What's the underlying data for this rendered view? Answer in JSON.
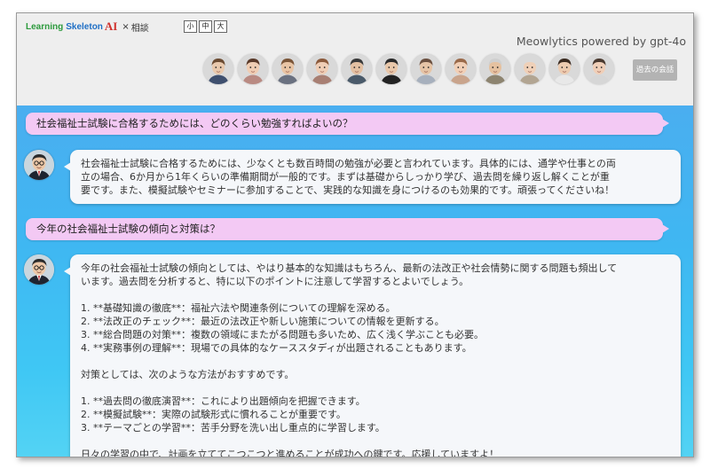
{
  "header": {
    "brand_learning": "Learning",
    "brand_skeleton": "Skeleton",
    "brand_ai": "AI",
    "brand_x": "×",
    "brand_consult": "相談",
    "font_sizes": [
      "小",
      "中",
      "大"
    ],
    "powered_by": "Meowlytics powered by gpt-4o",
    "past_conversations": "過去の会話"
  },
  "avatars": [
    {
      "icon": "businessman-avatar-icon",
      "skin": "#e9c9ad",
      "hair": "#6b4b32",
      "shirt": "#3e4f6e"
    },
    {
      "icon": "woman-avatar-icon",
      "skin": "#f0cdb3",
      "hair": "#5a3a2a",
      "shirt": "#b98a82"
    },
    {
      "icon": "man-avatar-icon",
      "skin": "#e8c4a4",
      "hair": "#7a5538",
      "shirt": "#6a7180"
    },
    {
      "icon": "woman-avatar-icon",
      "skin": "#efcdb5",
      "hair": "#8b5a3c",
      "shirt": "#a87f73"
    },
    {
      "icon": "man-avatar-icon",
      "skin": "#e3c0a2",
      "hair": "#3a3a3a",
      "shirt": "#4a5a6a"
    },
    {
      "icon": "glasses-man-avatar-icon",
      "skin": "#e8c7aa",
      "hair": "#2a2a2a",
      "shirt": "#222222"
    },
    {
      "icon": "man-avatar-icon",
      "skin": "#e6c4a6",
      "hair": "#6b5040",
      "shirt": "#a7b0bd"
    },
    {
      "icon": "woman-avatar-icon",
      "skin": "#f1cfb6",
      "hair": "#9a6a4a",
      "shirt": "#c9a48c"
    },
    {
      "icon": "elder-man-avatar-icon",
      "skin": "#e5c1a0",
      "hair": "#cfcfcf",
      "shirt": "#8d8470"
    },
    {
      "icon": "elder-woman-avatar-icon",
      "skin": "#efd0b8",
      "hair": "#d9d9d9",
      "shirt": "#b2a592"
    },
    {
      "icon": "young-man-avatar-icon",
      "skin": "#eccbb0",
      "hair": "#3a2a20",
      "shirt": "#e8e8e8"
    },
    {
      "icon": "woman-avatar-icon",
      "skin": "#f0cfb8",
      "hair": "#4a3a30",
      "shirt": "#d6d6d6"
    }
  ],
  "messages": [
    {
      "role": "user",
      "text": "社会福祉士試験に合格するためには、どのくらい勉強すればよいの？"
    },
    {
      "role": "assistant",
      "icon": "assistant-avatar-icon",
      "lines": [
        "社会福祉士試験に合格するためには、少なくとも数百時間の勉強が必要と言われています。具体的には、通学や仕事との両",
        "立の場合、6か月から1年くらいの準備期間が一般的です。まずは基礎からしっかり学び、過去問を繰り返し解くことが重",
        "要です。また、模擬試験やセミナーに参加することで、実践的な知識を身につけるのも効果的です。頑張ってくださいね！"
      ]
    },
    {
      "role": "user",
      "text": "今年の社会福祉士試験の傾向と対策は？"
    },
    {
      "role": "assistant",
      "icon": "assistant-avatar-icon",
      "lines": [
        "今年の社会福祉士試験の傾向としては、やはり基本的な知識はもちろん、最新の法改正や社会情勢に関する問題も頻出して",
        "います。過去問を分析すると、特に以下のポイントに注意して学習するとよいでしょう。",
        "",
        "1. **基礎知識の徹底**：福祉六法や関連条例についての理解を深める。",
        "2. **法改正のチェック**：最近の法改正や新しい施策についての情報を更新する。",
        "3. **総合問題の対策**：複数の領域にまたがる問題も多いため、広く浅く学ぶことも必要。",
        "4. **実務事例の理解**：現場での具体的なケーススタディが出題されることもあります。",
        "",
        "対策としては、次のような方法がおすすめです。",
        "",
        "1. **過去問の徹底演習**：これにより出題傾向を把握できます。",
        "2. **模擬試験**：実際の試験形式に慣れることが重要です。",
        "3. **テーマごとの学習**：苦手分野を洗い出し重点的に学習します。",
        "",
        "日々の学習の中で、計画を立ててこつこつと進めることが成功への鍵です。応援していますよ！"
      ]
    }
  ]
}
